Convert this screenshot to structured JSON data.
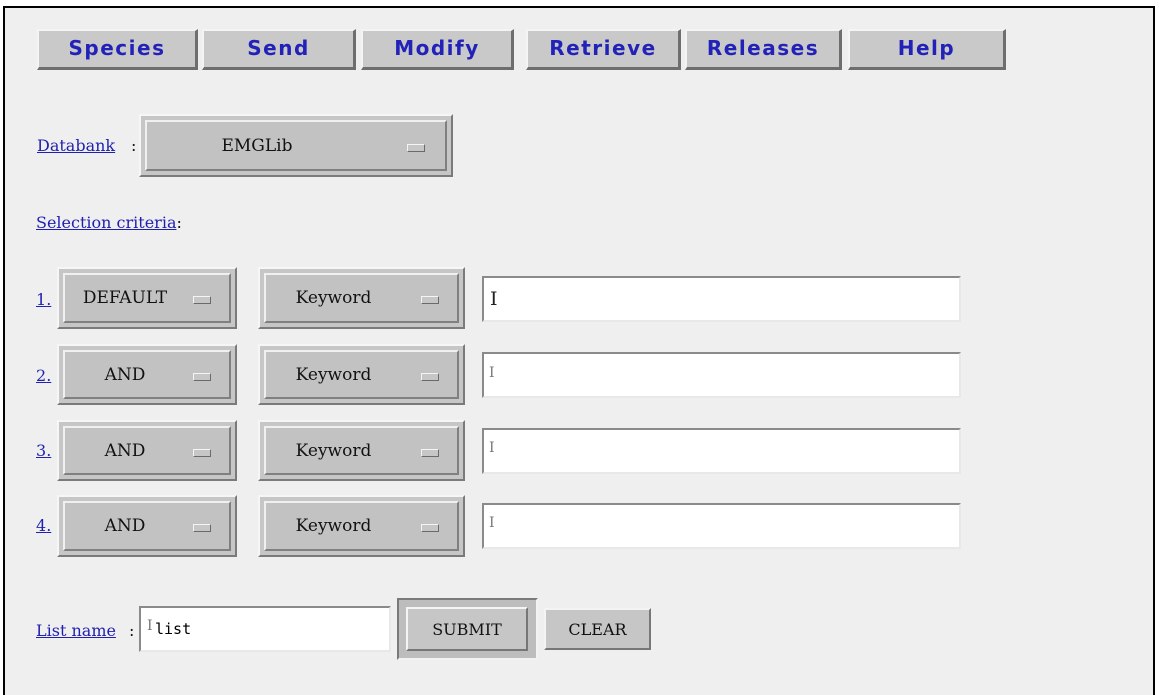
{
  "nav": {
    "buttons": [
      "Species",
      "Send",
      "Modify",
      "Retrieve",
      "Releases",
      "Help"
    ]
  },
  "databank": {
    "label": "Databank",
    "colon": ":",
    "selected": "EMGLib"
  },
  "selection": {
    "label": "Selection criteria",
    "colon": ":",
    "rows": [
      {
        "number": "1",
        "dot": ".",
        "operator": "DEFAULT",
        "field": "Keyword",
        "value": ""
      },
      {
        "number": "2",
        "dot": ".",
        "operator": "AND",
        "field": "Keyword",
        "value": ""
      },
      {
        "number": "3",
        "dot": ".",
        "operator": "AND",
        "field": "Keyword",
        "value": ""
      },
      {
        "number": "4",
        "dot": ".",
        "operator": "AND",
        "field": "Keyword",
        "value": ""
      }
    ]
  },
  "list": {
    "label": "List name",
    "colon": ":",
    "value": "list"
  },
  "actions": {
    "submit": "SUBMIT",
    "clear": "CLEAR"
  }
}
